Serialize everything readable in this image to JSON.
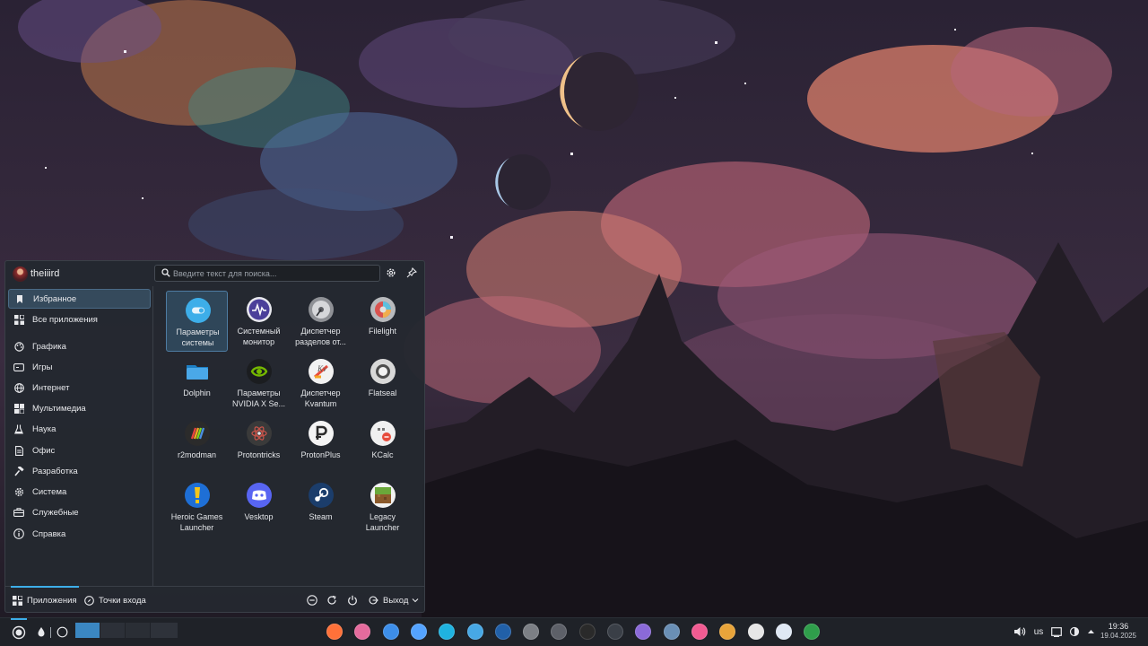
{
  "launcher": {
    "user": {
      "name": "theiiird"
    },
    "search": {
      "placeholder": "Введите текст для поиска..."
    },
    "categories": [
      {
        "label": "Избранное",
        "icon": "bookmark-icon",
        "active": true
      },
      {
        "label": "Все приложения",
        "icon": "grid-icon"
      },
      {
        "label": "Графика",
        "icon": "palette-icon"
      },
      {
        "label": "Игры",
        "icon": "gamepad-icon"
      },
      {
        "label": "Интернет",
        "icon": "globe-icon"
      },
      {
        "label": "Мультимедиа",
        "icon": "multimedia-icon"
      },
      {
        "label": "Наука",
        "icon": "flask-icon"
      },
      {
        "label": "Офис",
        "icon": "document-icon"
      },
      {
        "label": "Разработка",
        "icon": "hammer-icon"
      },
      {
        "label": "Система",
        "icon": "gear-icon"
      },
      {
        "label": "Служебные",
        "icon": "toolbox-icon"
      },
      {
        "label": "Справка",
        "icon": "info-icon"
      }
    ],
    "apps": [
      {
        "label": "Параметры системы",
        "icon": "system-settings-icon",
        "color": "#3daee9",
        "active": true
      },
      {
        "label": "Системный монитор",
        "icon": "system-monitor-icon",
        "color": "#5a4fa8"
      },
      {
        "label": "Диспетчер разделов от...",
        "icon": "partition-manager-icon",
        "color": "#9a9a9a"
      },
      {
        "label": "Filelight",
        "icon": "filelight-icon",
        "color": "#b0b0b0"
      },
      {
        "label": "Dolphin",
        "icon": "dolphin-icon",
        "color": "#4aa8e8"
      },
      {
        "label": "Параметры NVIDIA X Se...",
        "icon": "nvidia-icon",
        "color": "#76b900"
      },
      {
        "label": "Диспетчер Kvantum",
        "icon": "kvantum-icon",
        "color": "#f2f2f2"
      },
      {
        "label": "Flatseal",
        "icon": "flatseal-icon",
        "color": "#d8d8d8"
      },
      {
        "label": "r2modman",
        "icon": "r2modman-icon",
        "color": "#2b2b2b"
      },
      {
        "label": "Protontricks",
        "icon": "protontricks-icon",
        "color": "#3a3a3a"
      },
      {
        "label": "ProtonPlus",
        "icon": "protonplus-icon",
        "color": "#f4f4f4"
      },
      {
        "label": "KCalc",
        "icon": "kcalc-icon",
        "color": "#f0f0f0"
      },
      {
        "label": "Heroic Games Launcher",
        "icon": "heroic-icon",
        "color": "#1e6fd6"
      },
      {
        "label": "Vesktop",
        "icon": "vesktop-icon",
        "color": "#5865f2"
      },
      {
        "label": "Steam",
        "icon": "steam-icon",
        "color": "#1b3d6b"
      },
      {
        "label": "Legacy Launcher",
        "icon": "legacy-launcher-icon",
        "color": "#6aa83a"
      }
    ],
    "footer": {
      "apps_tab": "Приложения",
      "places_tab": "Точки входа",
      "exit_label": "Выход"
    }
  },
  "taskbar": {
    "pinned_apps": [
      {
        "name": "firefox-icon",
        "color": "#ff7139"
      },
      {
        "name": "kolourpaint-icon",
        "color": "#e56b9d"
      },
      {
        "name": "kate-icon",
        "color": "#3d8ee9"
      },
      {
        "name": "discover-icon",
        "color": "#54a3ff"
      },
      {
        "name": "kde-connect-icon",
        "color": "#1fb3e0"
      },
      {
        "name": "dolphin-icon",
        "color": "#47a8e5"
      },
      {
        "name": "powershell-icon",
        "color": "#2160a8"
      },
      {
        "name": "konsole-icon",
        "color": "#7c7f85"
      },
      {
        "name": "network-tool-icon",
        "color": "#5d6068"
      },
      {
        "name": "krita-icon",
        "color": "#2a2a2a"
      },
      {
        "name": "kdeconnect-sms-icon",
        "color": "#3a3f47"
      },
      {
        "name": "crystal-icon",
        "color": "#8b6ad8"
      },
      {
        "name": "virtual-machine-icon",
        "color": "#6a8fb5"
      },
      {
        "name": "feather-icon",
        "color": "#f25b92"
      },
      {
        "name": "layers-icon",
        "color": "#e8a43a"
      },
      {
        "name": "network-manager-icon",
        "color": "#e6e6e6"
      },
      {
        "name": "flatseal-shield-icon",
        "color": "#dfe8f4"
      },
      {
        "name": "spreadsheet-icon",
        "color": "#2f9e4b"
      }
    ],
    "keyboard_layout": "us",
    "clock": {
      "time": "19:36",
      "date": "19.04.2025"
    }
  }
}
